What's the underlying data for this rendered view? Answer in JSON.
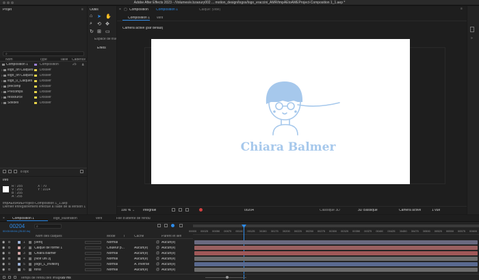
{
  "app": {
    "title": "Adobe After Effects 2023 - /Volumes/e.bzaoury002 ... motion_design/logos/logo_eraccini_AMR/tmpAEtoAMEProject-Composition 1_1.aep *"
  },
  "project": {
    "title": "Projet",
    "search_placeholder": "",
    "columns": [
      "Nom",
      "Type",
      "Taille",
      "Cadence"
    ],
    "items": [
      {
        "name": "Composition 1",
        "type": "Composition",
        "rate": "25",
        "color": "#9a7fd4"
      },
      {
        "name": "logo_on Calques",
        "type": "Dossier",
        "color": "#e8d34a"
      },
      {
        "name": "logo_on Calques",
        "type": "Dossier",
        "color": "#e8d34a"
      },
      {
        "name": "logo_0_Calques",
        "type": "Dossier",
        "color": "#e8d34a"
      },
      {
        "name": "précomp",
        "type": "Dossier",
        "color": "#e8d34a"
      },
      {
        "name": "Précomps",
        "type": "Dossier",
        "color": "#e8d34a"
      },
      {
        "name": "ressource",
        "type": "Dossier",
        "color": "#e8d34a"
      },
      {
        "name": "Solides",
        "type": "Dossier",
        "color": "#e8d34a"
      }
    ],
    "bpc": "8 bpc"
  },
  "info": {
    "title": "Info",
    "x_label": "X : 70",
    "y_label": "Y : 1014",
    "values": [
      "R : 255",
      "V : 255",
      "B : 255",
      "A : 255"
    ],
    "file": "tmpAEtoAMEProject-Composition 1_1.aep",
    "saved": "Dernier enregistrement effectué à l'aide de la version 17.1.3 (Ma"
  },
  "tools": {
    "title": "Outils",
    "workspace": "Espace de trava",
    "effects_tab": "Effets"
  },
  "composition": {
    "tab_label": "Composition",
    "tab_name": "Composition 1",
    "layer_tab": "Calque: (vide)",
    "subtab": "Composition 1",
    "subtab2": "vent",
    "camera": "Caméra active (par défaut)",
    "logo_text": "Chiara Balmer",
    "zoom": "100 %",
    "resolution": "Intégrale",
    "timecode": "00204",
    "renderer": "Classique 3D",
    "renderer_btn": "3D classique",
    "camera_select": "Caméra active",
    "views": "1 vue"
  },
  "timeline": {
    "tabs": [
      "Composition 1",
      "logo_illustration",
      "vent",
      "File d'attente de rendu"
    ],
    "timecode": "00204",
    "timecode_sub": "00:00:08:04 (25.00 i/s)",
    "columns": [
      "Nom des calques",
      "Mode",
      "T",
      "Cache",
      "Parent et lien"
    ],
    "layers": [
      {
        "num": "1",
        "name": "[vent]",
        "mode": "Normal",
        "cache": "",
        "parent": "Aucun(e)",
        "color": "#9ab0d6"
      },
      {
        "num": "2",
        "name": "Calque de forme 1",
        "mode": "Couleur p...",
        "cache": "Aucun(e)",
        "parent": "Aucun(e)",
        "color": "#d6a6a6"
      },
      {
        "num": "3",
        "name": "Chiara Balmer",
        "mode": "Normal",
        "cache": "Aucun(e)",
        "parent": "Aucun(e)",
        "color": "#d6a6a6"
      },
      {
        "num": "4",
        "name": "[Noir uni 3]",
        "mode": "Normal",
        "cache": "Aucun(e)",
        "parent": "Aucun(e)",
        "color": "#9e9e9e"
      },
      {
        "num": "5",
        "name": "[logo_L_invition]",
        "mode": "Normal",
        "cache": "A. inversé",
        "parent": "Aucun(e)",
        "color": "#9ab0d6"
      },
      {
        "num": "6",
        "name": "fond",
        "mode": "Normal",
        "cache": "Aucun(e)",
        "parent": "Aucun(e)",
        "color": "#9e9e9e"
      }
    ],
    "ruler": [
      "00000",
      "00025",
      "00050",
      "00075",
      "00100",
      "00125",
      "00150",
      "00175",
      "00200",
      "00225",
      "00250",
      "00275",
      "00300",
      "00325",
      "00350",
      "00375",
      "00400",
      "00425",
      "00450",
      "00475",
      "00500",
      "00525",
      "00550",
      "00575",
      "00600"
    ],
    "render_time_label": "Temps de rendu des images",
    "render_time": "29 ms"
  },
  "colors": {
    "accent": "#2d8ceb",
    "logo": "#a6c8ec"
  }
}
